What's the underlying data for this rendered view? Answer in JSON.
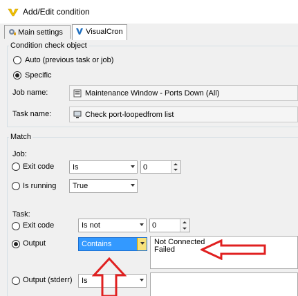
{
  "window": {
    "title": "Add/Edit condition"
  },
  "tabs": [
    {
      "label": "Main settings"
    },
    {
      "label": "VisualCron"
    }
  ],
  "condition_check_object": {
    "legend": "Condition check object",
    "auto_label": "Auto (previous task or job)",
    "specific_label": "Specific",
    "job_name_label": "Job name:",
    "job_name_value": "Maintenance Window - Ports Down (All)",
    "task_name_label": "Task name:",
    "task_name_value": "Check port-loopedfrom list"
  },
  "match": {
    "legend": "Match",
    "job_heading": "Job:",
    "job_exit_code_label": "Exit code",
    "job_exit_code_op": "Is",
    "job_exit_code_value": "0",
    "job_running_label": "Is running",
    "job_running_value": "True",
    "task_heading": "Task:",
    "task_exit_code_label": "Exit code",
    "task_exit_code_op": "Is not",
    "task_exit_code_value": "0",
    "task_output_label": "Output",
    "task_output_op": "Contains",
    "task_output_value": "Not Connected\nFailed",
    "task_stderr_label": "Output (stderr)",
    "task_stderr_op": "Is"
  },
  "colors": {
    "annotation_arrow": "#e02020",
    "selected_highlight": "#3399ff"
  }
}
